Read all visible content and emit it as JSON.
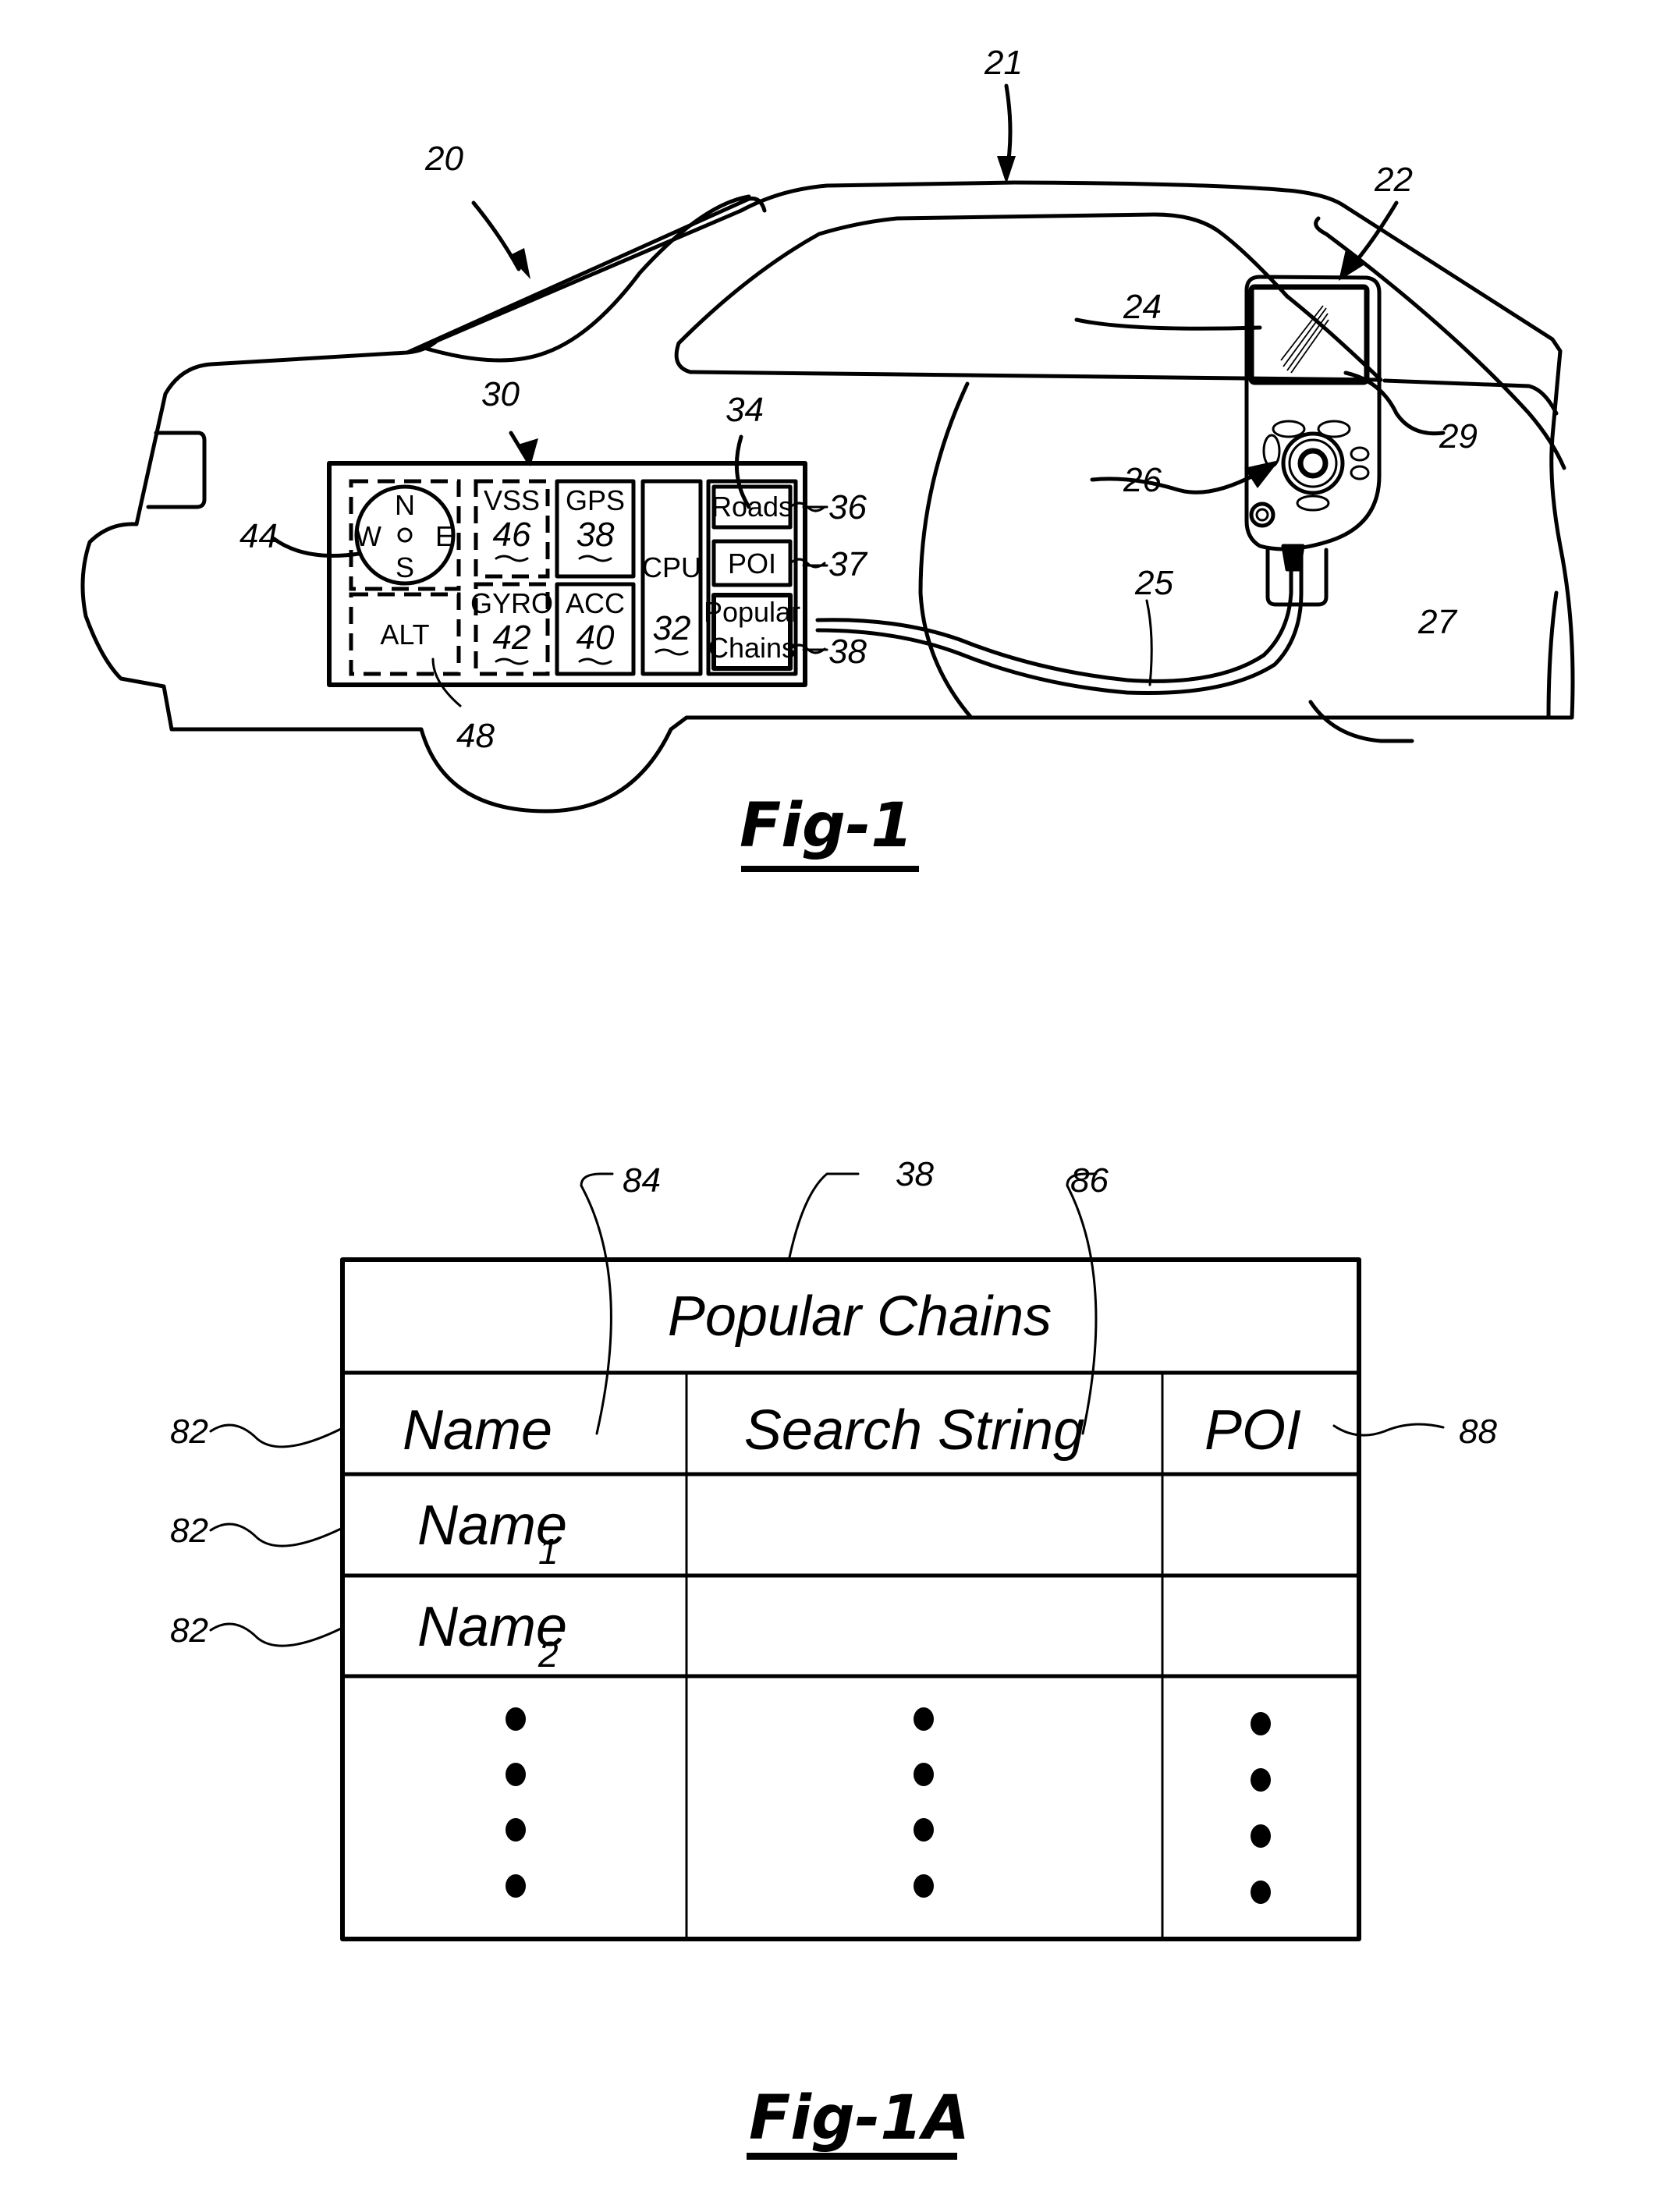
{
  "fig1": {
    "caption": "Fig-1",
    "refs": {
      "vehicle": "20",
      "roof": "21",
      "device": "22",
      "screen": "24",
      "cable": "25",
      "joystick": "26",
      "mount": "27",
      "display": "29",
      "nav_unit": "30",
      "database": "34",
      "roads_ref": "36",
      "poi_ref": "37",
      "chains_ref": "38",
      "compass": "44",
      "alt": "48"
    },
    "compass": {
      "n": "N",
      "s": "S",
      "e": "E",
      "w": "W"
    },
    "modules": {
      "alt": "ALT",
      "vss": "VSS",
      "vss_num": "46",
      "gps": "GPS",
      "gps_num": "38",
      "gyro": "GYRO",
      "gyro_num": "42",
      "acc": "ACC",
      "acc_num": "40",
      "cpu": "CPU",
      "cpu_num": "32"
    },
    "database": {
      "roads": "Roads",
      "poi": "POI",
      "chains_line1": "Popular",
      "chains_line2": "Chains"
    }
  },
  "fig1a": {
    "caption": "Fig-1A",
    "refs": {
      "table": "38",
      "name_col": "84",
      "search_col": "86",
      "poi_col": "88",
      "row": "82"
    },
    "table": {
      "title": "Popular Chains",
      "columns": [
        "Name",
        "Search String",
        "POI"
      ],
      "rows": [
        {
          "name": "Name",
          "sub": "1",
          "search": "",
          "poi": ""
        },
        {
          "name": "Name",
          "sub": "2",
          "search": "",
          "poi": ""
        }
      ],
      "continuation": "•"
    }
  }
}
